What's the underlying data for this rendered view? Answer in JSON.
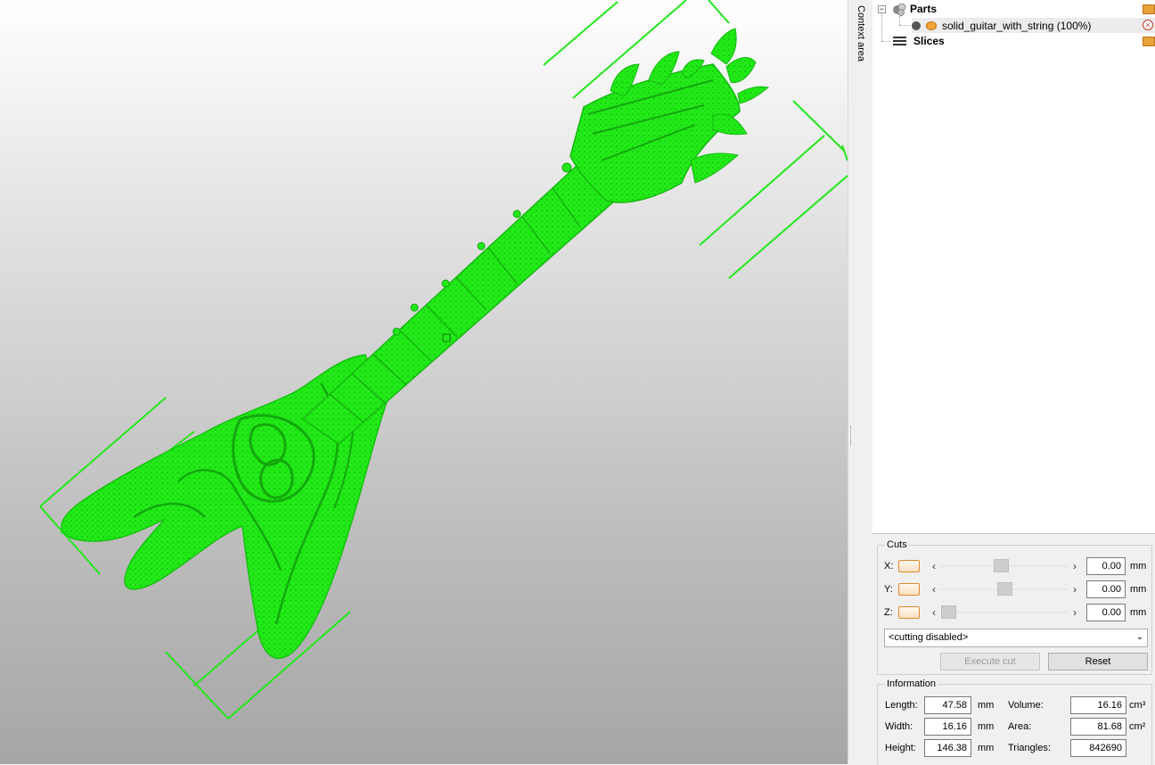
{
  "context_tab_label": "Context area",
  "tree": {
    "parts_label": "Parts",
    "part_item_label": "solid_guitar_with_string (100%)",
    "slices_label": "Slices"
  },
  "cuts": {
    "title": "Cuts",
    "axes": [
      {
        "label": "X:",
        "value": "0.00",
        "unit": "mm",
        "slider_fraction": 0.47
      },
      {
        "label": "Y:",
        "value": "0.00",
        "unit": "mm",
        "slider_fraction": 0.5
      },
      {
        "label": "Z:",
        "value": "0.00",
        "unit": "mm",
        "slider_fraction": 0.0
      }
    ],
    "mode_selected": "<cutting disabled>",
    "execute_label": "Execute cut",
    "reset_label": "Reset"
  },
  "information": {
    "title": "Information",
    "length_label": "Length:",
    "length_value": "47.58",
    "length_unit": "mm",
    "width_label": "Width:",
    "width_value": "16.16",
    "width_unit": "mm",
    "height_label": "Height:",
    "height_value": "146.38",
    "height_unit": "mm",
    "volume_label": "Volume:",
    "volume_value": "16.16",
    "volume_unit": "cm³",
    "area_label": "Area:",
    "area_value": "81.68",
    "area_unit": "cm²",
    "triangles_label": "Triangles:",
    "triangles_value": "842690"
  },
  "colors": {
    "model": "#22e81a",
    "bounding_box": "#22e81a",
    "viewport_top": "#ffffff",
    "viewport_bottom": "#a6a6a6"
  }
}
